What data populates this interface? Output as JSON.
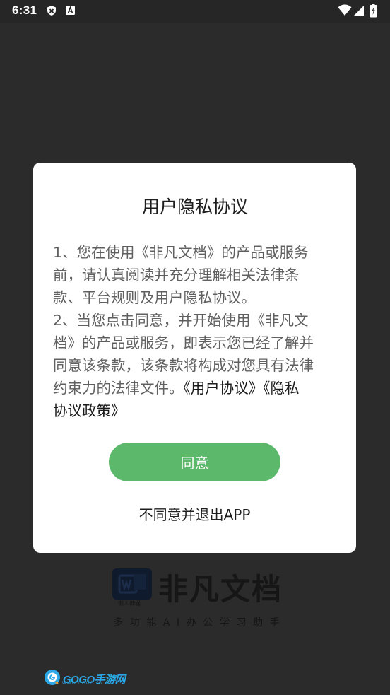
{
  "status_bar": {
    "time": "6:31",
    "icons": [
      "shield-notification-icon",
      "font-notification-icon",
      "wifi-icon",
      "signal-icon",
      "battery-icon"
    ]
  },
  "dialog": {
    "title": "用户隐私协议",
    "paragraph1_lines": [
      "1、您在使用《非凡文档》的产品或服务",
      "前，请认真阅读并充分理解相关法律条",
      "款、平台规则及用户隐私协议。"
    ],
    "paragraph2_lines": [
      "2、当您点击同意，并开始使用《非凡文",
      "档》的产品或服务，即表示您已经了解并",
      "同意该条款，该条款将构成对您具有法律"
    ],
    "paragraph2_tail": "约束力的法律文件。",
    "user_agreement_link": "《用户协议》",
    "privacy_policy_link_line1": "《隐私",
    "privacy_policy_link_line2": "协议政策》",
    "agree_label": "同意",
    "exit_label": "不同意并退出APP"
  },
  "splash": {
    "app_name": "非凡文档",
    "tagline": "多功能AI办公学习助手",
    "logo_caption": "懒人神器"
  },
  "watermark": {
    "text": "GOGO手游网",
    "sub": "WWW.GOGO.CN"
  },
  "colors": {
    "background": "#2b2b2b",
    "dialog": "#ffffff",
    "accent_green": "#5cb96c",
    "body_text": "#606060"
  }
}
